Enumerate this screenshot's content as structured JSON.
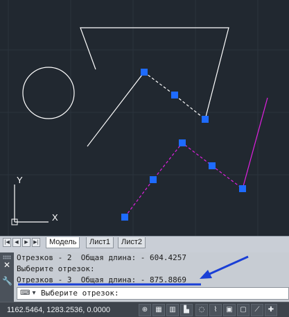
{
  "canvas": {
    "background": "#212830",
    "grid_color": "#2b333d",
    "ucs": {
      "y_label": "Y",
      "x_label": "X"
    },
    "colors": {
      "white": "#ffffff",
      "magenta": "#e020e0",
      "grip": "#1e6bff"
    }
  },
  "layout_tabs": {
    "nav_buttons": [
      "first-icon",
      "prev-icon",
      "next-icon",
      "last-icon"
    ],
    "tabs": [
      {
        "label": "Модель",
        "active": true
      },
      {
        "label": "Лист1",
        "active": false
      },
      {
        "label": "Лист2",
        "active": false
      }
    ]
  },
  "command_window": {
    "history": [
      "Отрезков - 2  Общая длина: - 604.4257",
      "Выберите отрезок:",
      "Отрезков - 3  Общая длина: - 875.8869"
    ],
    "prompt": "Выберите отрезок:",
    "highlight_color": "#1a3fd6"
  },
  "status_bar": {
    "coordinates": "1162.5464, 1283.2536, 0.0000",
    "buttons": [
      "snap-icon",
      "grid-icon",
      "ortho-icon",
      "polar-icon",
      "osnap-icon",
      "otrack-icon",
      "ducs-icon",
      "dyn-icon",
      "lwt-icon",
      "qp-icon"
    ]
  }
}
